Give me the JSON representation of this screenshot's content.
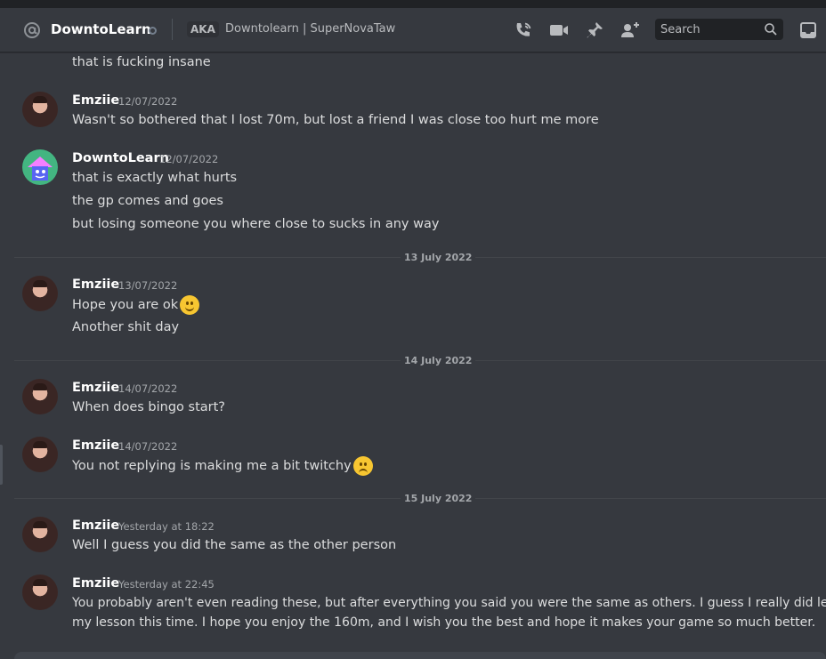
{
  "header": {
    "name": "DowntoLearn",
    "aka": "AKA",
    "nicknames": "Downtolearn | SuperNovaTaw",
    "search_placeholder": "Search",
    "icons": [
      "at-icon",
      "voice-call-icon",
      "video-call-icon",
      "pin-icon",
      "add-friend-icon",
      "search-icon",
      "inbox-icon"
    ]
  },
  "messages": {
    "m0": {
      "text": "that is fucking insane"
    },
    "m1": {
      "author": "Emziie",
      "timestamp": "12/07/2022",
      "lines": [
        "Wasn't so bothered that I lost 70m, but lost a friend I was close too hurt me more"
      ]
    },
    "m2": {
      "author": "DowntoLearn",
      "timestamp": "12/07/2022",
      "lines": [
        "that is exactly what hurts",
        "the gp comes and goes",
        "but losing someone you where close to sucks in any way"
      ]
    },
    "d1": "13 July 2022",
    "m3": {
      "author": "Emziie",
      "timestamp": "13/07/2022",
      "lines": [
        "Hope you are ok",
        "Another shit day"
      ],
      "emoji": "slightly-smiling-face"
    },
    "d2": "14 July 2022",
    "m4": {
      "author": "Emziie",
      "timestamp": "14/07/2022",
      "lines": [
        "When does bingo start?"
      ]
    },
    "m5": {
      "author": "Emziie",
      "timestamp": "14/07/2022",
      "lines": [
        "You not replying is making me a bit twitchy"
      ],
      "emoji": "frowning-face"
    },
    "d3": "15 July 2022",
    "m6": {
      "author": "Emziie",
      "timestamp": "Yesterday at 18:22",
      "lines": [
        "Well I guess you did the same as the other person"
      ]
    },
    "m7": {
      "author": "Emziie",
      "timestamp": "Yesterday at 22:45",
      "lines": [
        "You probably aren't even reading these, but after everything you said you were the same as others. I guess I really did learn",
        "my lesson this time. I hope you enjoy the 160m, and I wish you the best and hope it makes your game so much better."
      ]
    }
  },
  "colors": {
    "background": "#36393f",
    "header_bg": "#36393f",
    "text": "#dcddde",
    "muted": "#a3a6aa",
    "online_green": "#43b581"
  }
}
